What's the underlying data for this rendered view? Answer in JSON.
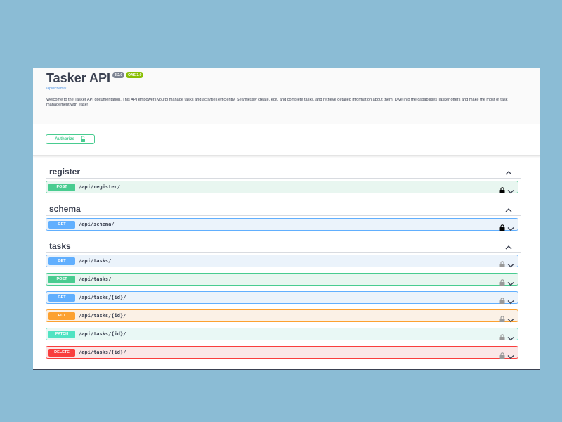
{
  "info": {
    "title": "Tasker API",
    "version_badge": "3.2.0",
    "oas_badge": "OAS 3.0",
    "schema_link": "/api/schema/",
    "description": "Welcome to the Tasker API documentation. This API empowers you to manage tasks and activities efficiently. Seamlessly create, edit, and complete tasks, and retrieve detailed information about them. Dive into the capabilities Tasker offers and make the most of task management with ease!"
  },
  "authorize": {
    "label": "Authorize"
  },
  "tags": [
    {
      "name": "register",
      "operations": [
        {
          "method": "POST",
          "path": "/api/register/",
          "lock": "locked-icon"
        }
      ]
    },
    {
      "name": "schema",
      "operations": [
        {
          "method": "GET",
          "path": "/api/schema/",
          "lock": "locked-icon"
        }
      ]
    },
    {
      "name": "tasks",
      "operations": [
        {
          "method": "GET",
          "path": "/api/tasks/",
          "lock": "unlocked-icon"
        },
        {
          "method": "POST",
          "path": "/api/tasks/",
          "lock": "unlocked-icon"
        },
        {
          "method": "GET",
          "path": "/api/tasks/{id}/",
          "lock": "unlocked-icon"
        },
        {
          "method": "PUT",
          "path": "/api/tasks/{id}/",
          "lock": "unlocked-icon"
        },
        {
          "method": "PATCH",
          "path": "/api/tasks/{id}/",
          "lock": "unlocked-icon"
        },
        {
          "method": "DELETE",
          "path": "/api/tasks/{id}/",
          "lock": "unlocked-icon"
        }
      ]
    }
  ],
  "colors": {
    "post": "#49cc90",
    "get": "#61affe",
    "put": "#fca130",
    "patch": "#50e3c2",
    "delete": "#f93e3e"
  }
}
